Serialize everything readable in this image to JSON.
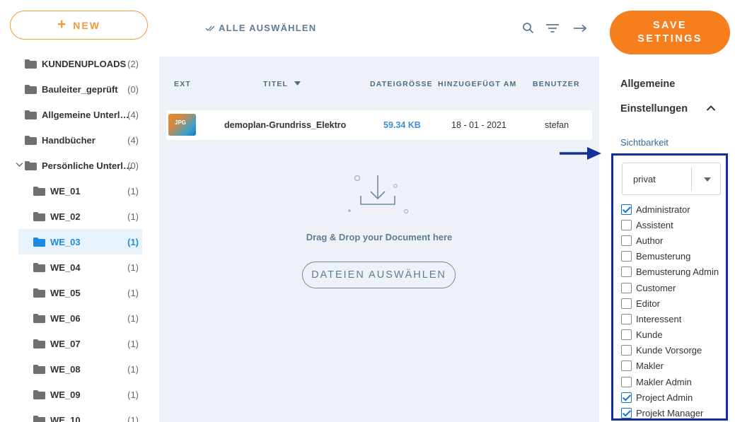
{
  "sidebar": {
    "new_button_plus": "+",
    "new_button_label": "NEW",
    "folders": [
      {
        "label": "KUNDENUPLOADS",
        "count": "(2)"
      },
      {
        "label": "Bauleiter_geprüft",
        "count": "(0)"
      },
      {
        "label": "Allgemeine Unterl…",
        "count": "(4)"
      },
      {
        "label": "Handbücher",
        "count": "(4)"
      },
      {
        "label": "Persönliche Unterl…",
        "count": "(0)"
      }
    ],
    "subfolders": [
      {
        "label": "WE_01",
        "count": "(1)"
      },
      {
        "label": "WE_02",
        "count": "(1)"
      },
      {
        "label": "WE_03",
        "count": "(1)"
      },
      {
        "label": "WE_04",
        "count": "(1)"
      },
      {
        "label": "WE_05",
        "count": "(1)"
      },
      {
        "label": "WE_06",
        "count": "(1)"
      },
      {
        "label": "WE_07",
        "count": "(1)"
      },
      {
        "label": "WE_08",
        "count": "(1)"
      },
      {
        "label": "WE_09",
        "count": "(1)"
      },
      {
        "label": "WE_10",
        "count": "(1)"
      }
    ]
  },
  "toolbar": {
    "select_all_label": "ALLE AUSWÄHLEN",
    "icons": [
      "search-icon",
      "filter-icon",
      "arrow-right-icon"
    ]
  },
  "table": {
    "columns": {
      "ext": "EXT",
      "title": "TITEL",
      "size": "DATEIGRÖSSE",
      "added": "HINZUGEFÜGT AM",
      "user": "BENUTZER"
    },
    "rows": [
      {
        "ext": "JPG",
        "title": "demoplan-Grundriss_Elektro",
        "size": "59.34 KB",
        "added": "18 - 01 - 2021",
        "user": "stefan"
      }
    ]
  },
  "dropzone": {
    "text": "Drag & Drop your Document here",
    "button_label": "DATEIEN AUSWÄHLEN"
  },
  "settings": {
    "save_line1": "SAVE",
    "save_line2": "SETTINGS",
    "heading1": "Allgemeine",
    "heading2": "Einstellungen",
    "visibility_label": "Sichtbarkeit",
    "visibility_value": "privat",
    "roles": [
      {
        "label": "Administrator",
        "checked": true
      },
      {
        "label": "Assistent",
        "checked": false
      },
      {
        "label": "Author",
        "checked": false
      },
      {
        "label": "Bemusterung",
        "checked": false
      },
      {
        "label": "Bemusterung Admin",
        "checked": false
      },
      {
        "label": "Customer",
        "checked": false
      },
      {
        "label": "Editor",
        "checked": false
      },
      {
        "label": "Interessent",
        "checked": false
      },
      {
        "label": "Kunde",
        "checked": false
      },
      {
        "label": "Kunde Vorsorge",
        "checked": false
      },
      {
        "label": "Makler",
        "checked": false
      },
      {
        "label": "Makler Admin",
        "checked": false
      },
      {
        "label": "Project Admin",
        "checked": true
      },
      {
        "label": "Projekt Manager",
        "checked": true
      }
    ]
  },
  "colors": {
    "accent_orange": "#f67e1c",
    "active_blue": "#1a8be0",
    "annotation_navy": "#13309a",
    "panel_bg": "#eef2f8"
  }
}
